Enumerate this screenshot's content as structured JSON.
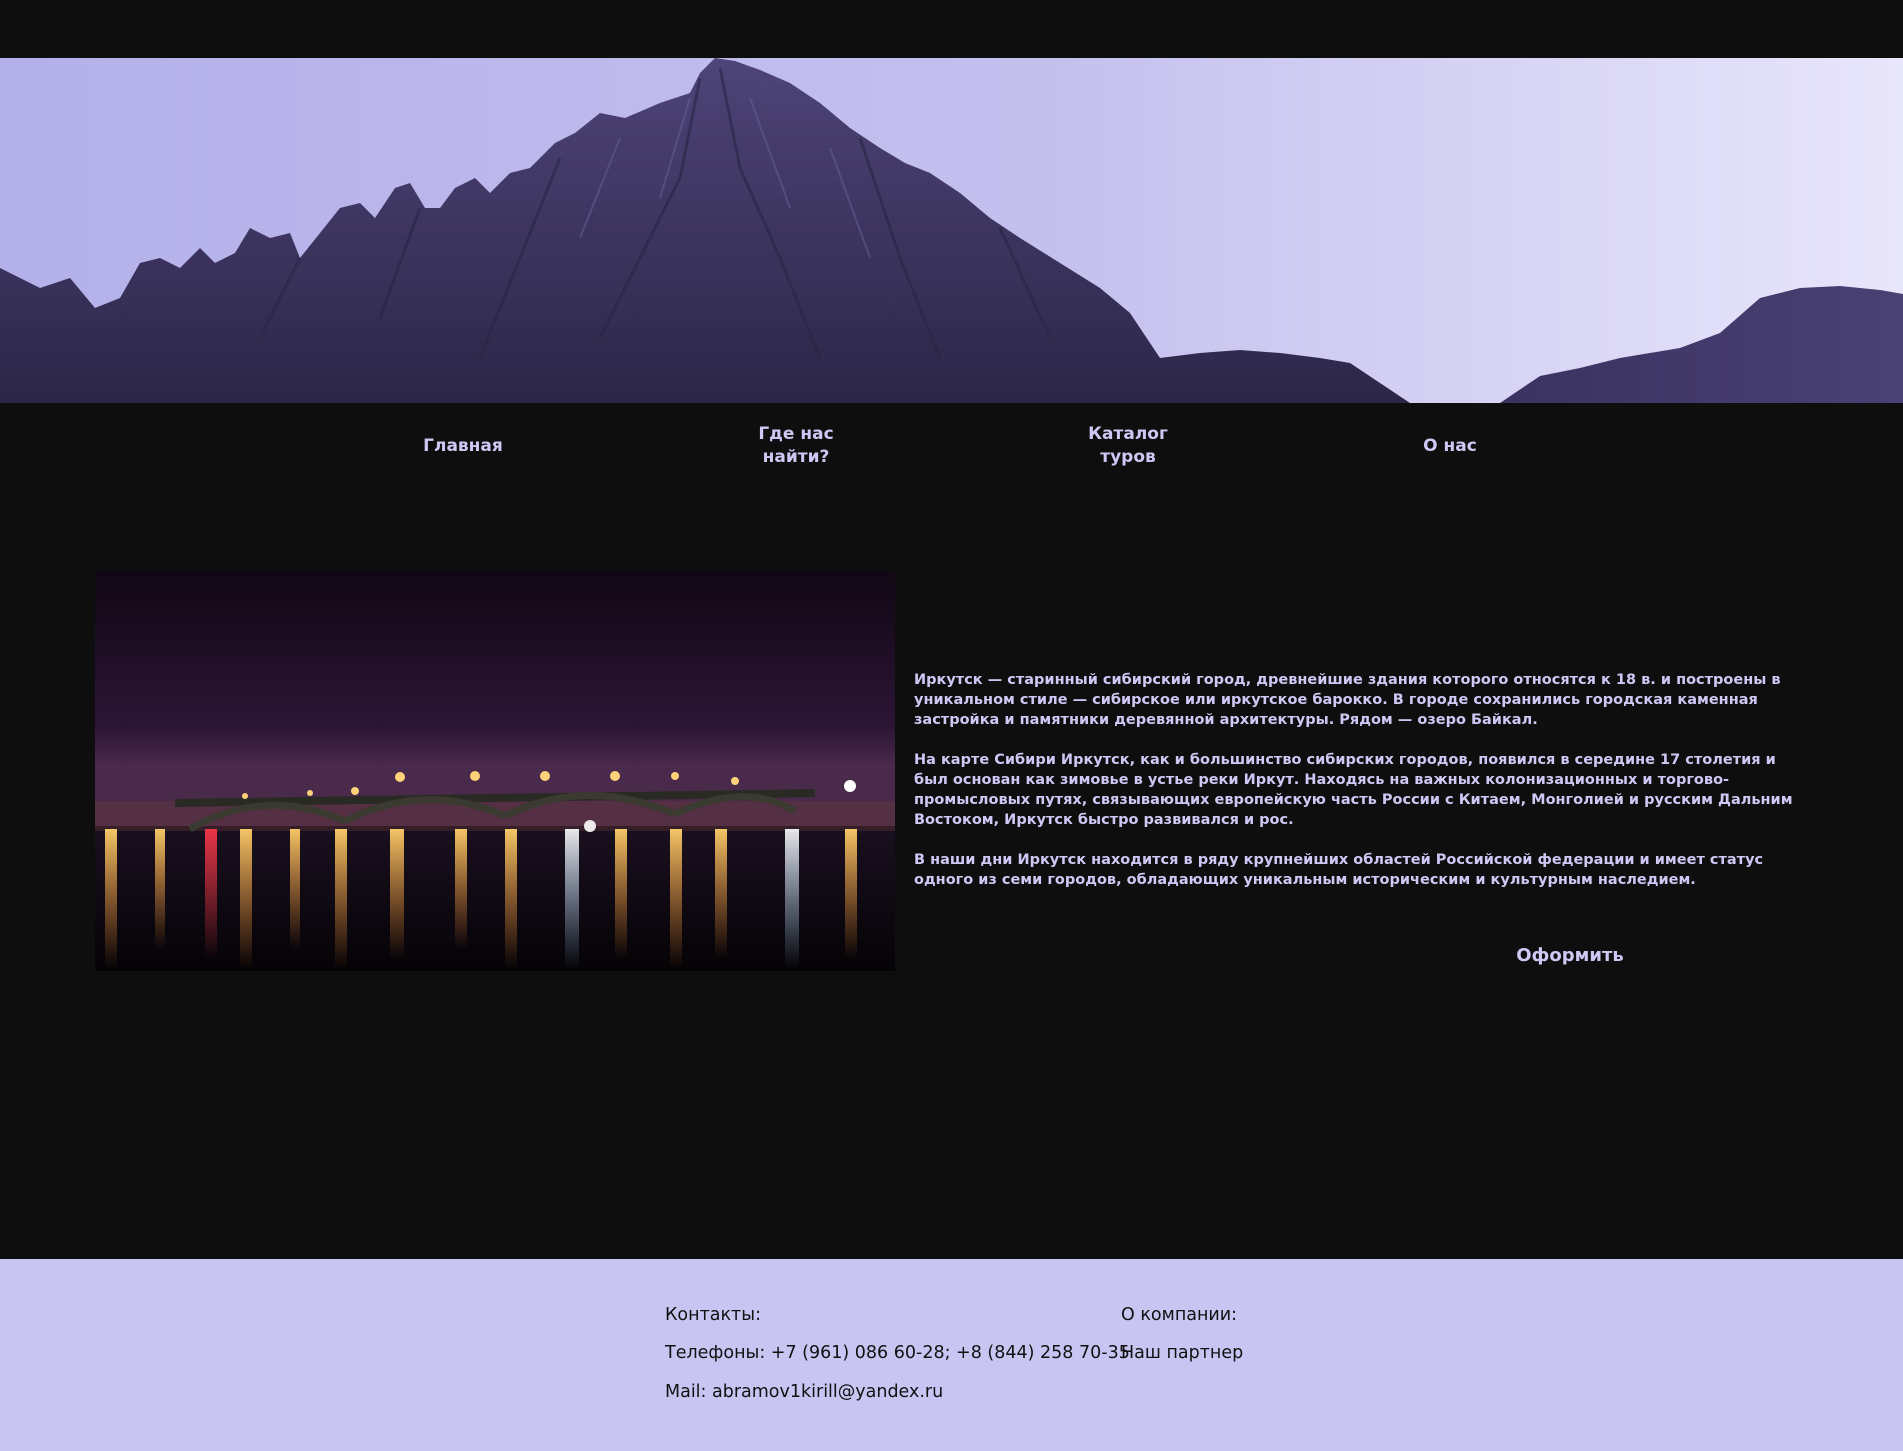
{
  "nav": {
    "items": [
      {
        "label": "Главная"
      },
      {
        "label_line1": "Где нас",
        "label_line2": "найти?"
      },
      {
        "label_line1": "Каталог",
        "label_line2": "туров"
      },
      {
        "label": "О нас"
      }
    ]
  },
  "hero": {
    "image": "mountain-peak-twilight"
  },
  "main": {
    "photo": "irkutsk-bridge-night",
    "paragraphs": [
      "Иркутск — старинный сибирский город, древнейшие здания которого относятся к 18 в. и построены в уникальном стиле — сибирское или иркутское барокко. В городе сохранились городская каменная застройка и памятники деревянной архитектуры. Рядом — озеро Байкал.",
      "На карте Сибири Иркутск, как и большинство сибирских городов, появился в середине 17 столетия и был основан как зимовье в устье реки Иркут. Находясь на важных колонизационных и торгово-промысловых путях, связывающих европейскую часть России с Китаем, Монголией и русским Дальним Востоком, Иркутск быстро развивался и рос.",
      "В наши дни Иркутск находится в ряду крупнейших областей Российской федерации и имеет статус одного из семи городов, обладающих уникальным историческим и культурным наследием."
    ],
    "order_button": "Оформить"
  },
  "footer": {
    "contacts_title": "Контакты:",
    "phones": "Телефоны: +7 (961) 086 60-28; +8 (844) 258 70-35",
    "mail": "Mail: abramov1kirill@yandex.ru",
    "company_title": "О компании:",
    "partner": "Наш партнер"
  },
  "colors": {
    "background": "#0e0e0e",
    "accent_text": "#cdc8f4",
    "footer_bg": "#c8c5f2"
  }
}
